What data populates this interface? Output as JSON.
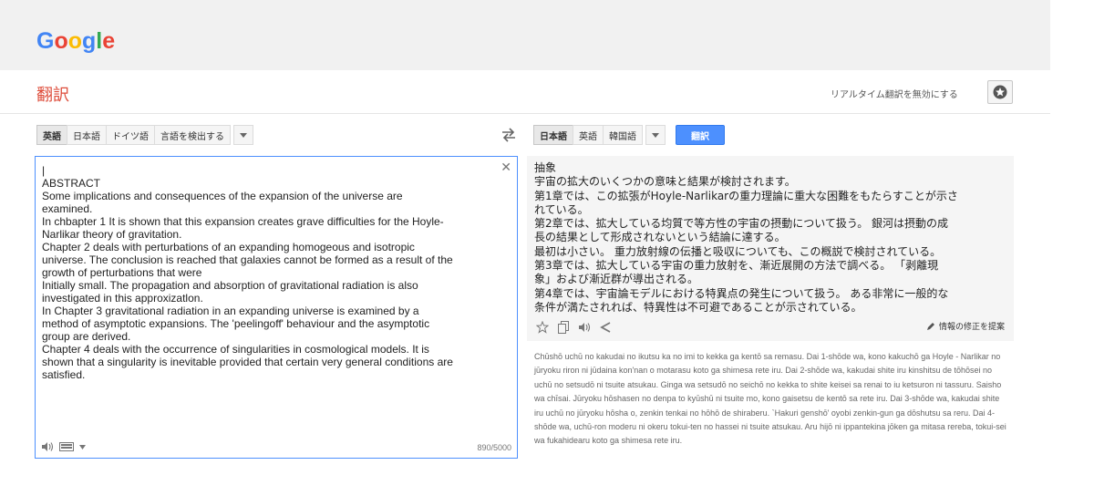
{
  "logo": {
    "letters": [
      "G",
      "o",
      "o",
      "g",
      "l",
      "e"
    ],
    "colors": [
      "#4285f4",
      "#ea4335",
      "#fbbc05",
      "#4285f4",
      "#34a853",
      "#ea4335"
    ]
  },
  "header": {
    "title": "翻訳",
    "realtime_toggle": "リアルタイム翻訳を無効にする",
    "star_icon": "star-icon"
  },
  "source_langs": {
    "items": [
      "英語",
      "日本語",
      "ドイツ語",
      "言語を検出する"
    ],
    "selected_index": 0
  },
  "target_langs": {
    "items": [
      "日本語",
      "英語",
      "韓国語"
    ],
    "selected_index": 0
  },
  "translate_button": "翻訳",
  "source": {
    "text": "|\nABSTRACT\nSome implications and consequences of the expansion of the universe are\nexamined.\nIn chbapter 1 It is shown that this expansion creates grave difficulties for the Hoyle-\nNarlikar theory of gravitation.\nChapter 2 deals with perturbations of an expanding homogeous and isotropic\nuniverse. The conclusion is reached that galaxies cannot be formed as a result of the\ngrowth of perturbations that were\nInitially small. The propagation and absorption of gravitational radiation is also\ninvestigated in this approxizatlon.\nIn Chapter 3 gravitational radiation in an expanding universe is examined by a\nmethod of asymptotic expansions. The 'peelingoff' behaviour and the asymptotic\ngroup are derived.\nChapter 4 deals with the occurrence of singularities in cosmological models. It is\nshown that a singularity is inevitable provided that certain very general conditions are\nsatisfied.",
    "char_count": "890/5000"
  },
  "result": {
    "text": "抽象\n宇宙の拡大のいくつかの意味と結果が検討されます。\n第1章では、この拡張がHoyle-Narlikarの重力理論に重大な困難をもたらすことが示さ\nれている。\n第2章では、拡大している均質で等方性の宇宙の摂動について扱う。 銀河は摂動の成\n長の結果として形成されないという結論に達する。\n最初は小さい。 重力放射線の伝播と吸収についても、この概説で検討されている。\n第3章では、拡大している宇宙の重力放射を、漸近展開の方法で調べる。 「剥離現\n象」および漸近群が導出される。\n第4章では、宇宙論モデルにおける特異点の発生について扱う。 ある非常に一般的な\n条件が満たされれば、特異性は不可避であることが示されている。",
    "suggest_edit": "情報の修正を提案"
  },
  "romaji": {
    "text": "Chūshō uchū no kakudai no ikutsu ka no imi to kekka ga kentō sa remasu. Dai 1-shōde wa, kono kakuchō ga Hoyle - Narlikar no jūryoku riron ni jūdaina kon'nan o motarasu koto ga shimesa rete iru. Dai 2-shōde wa, kakudai shite iru kinshitsu de tōhōsei no uchū no setsudō ni tsuite atsukau. Ginga wa setsudō no seichō no kekka to shite keisei sa renai to iu ketsuron ni tassuru. Saisho wa chīsai. Jūryoku hōshasen no denpa to kyūshū ni tsuite mo, kono gaisetsu de kentō sa rete iru. Dai 3-shōde wa, kakudai shite iru uchū no jūryoku hōsha o, zenkin tenkai no hōhō de shiraberu. `Hakuri genshō' oyobi zenkin-gun ga dōshutsu sa reru. Dai 4-shōde wa, uchū-ron moderu ni okeru tokui-ten no hassei ni tsuite atsukau. Aru hijō ni ippantekina jōken ga mitasa rereba, tokui-sei wa fukahidearu koto ga shimesa rete iru."
  }
}
